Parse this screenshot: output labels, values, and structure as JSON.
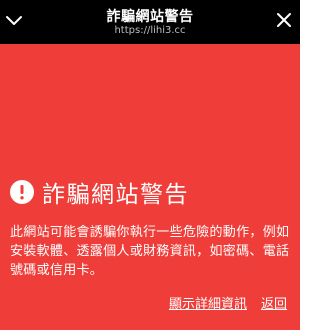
{
  "colors": {
    "background": "#ef3e3a",
    "topbar": "#000000",
    "text": "#ffffff"
  },
  "topbar": {
    "title": "詐騙網站警告",
    "url": "https://lihi3.cc",
    "left_icon": "chevron-down-icon",
    "right_icon": "close-icon"
  },
  "warning": {
    "icon": "exclamation-circle-icon",
    "heading": "詐騙網站警告",
    "body": "此網站可能會誘騙你執行一些危險的動作，例如安裝軟體、透露個人或財務資訊，如密碼、電話號碼或信用卡。"
  },
  "actions": {
    "details_label": "顯示詳細資訊",
    "back_label": "返回"
  }
}
